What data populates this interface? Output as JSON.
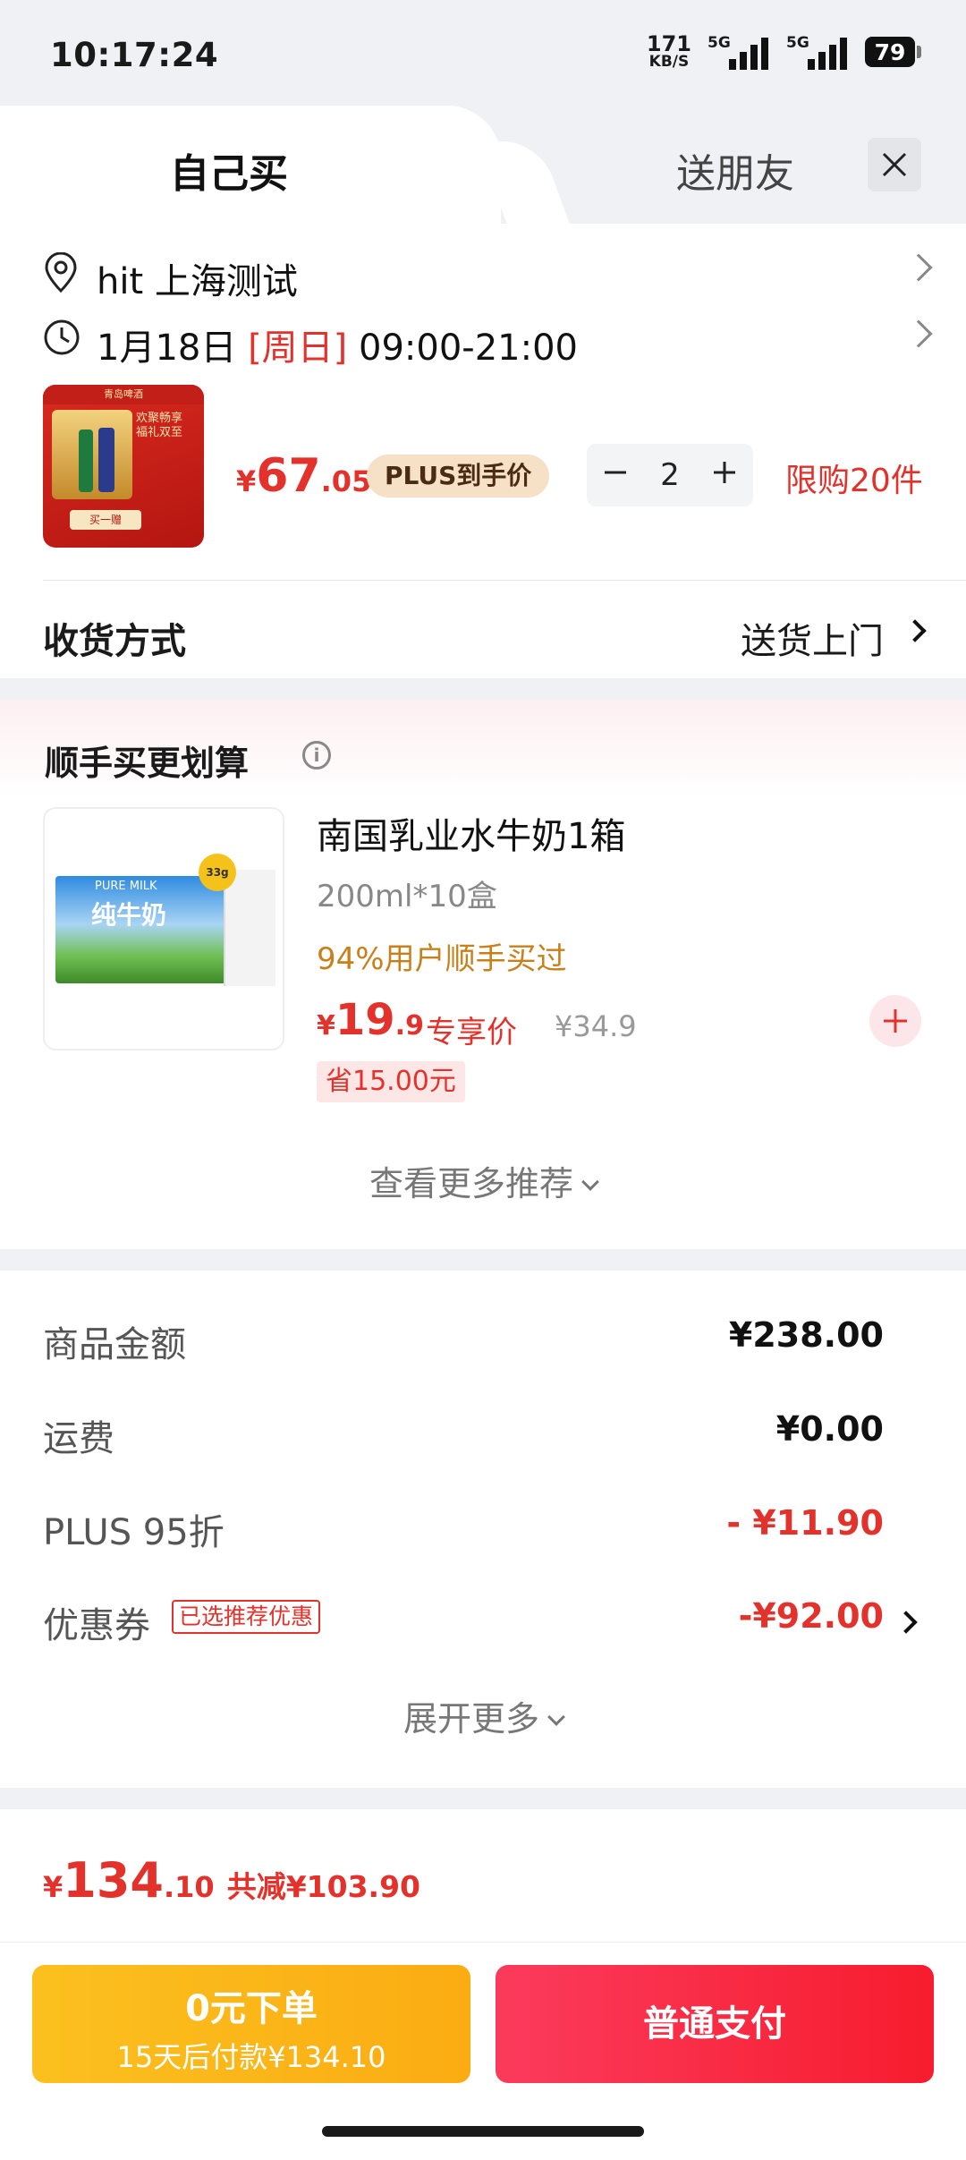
{
  "status_bar": {
    "time": "10:17:24",
    "speed_value": "171",
    "speed_unit": "KB/S",
    "network1": "5G",
    "network2": "5G",
    "battery": "79"
  },
  "tabs": {
    "self": "自己买",
    "gift": "送朋友"
  },
  "address": {
    "name": "hit",
    "text": "上海测试"
  },
  "delivery_time": {
    "date": "1月18日",
    "weekday": "[周日]",
    "range": "09:00-21:00"
  },
  "product": {
    "image_label": "product-beer-gift-box",
    "image_top": "青岛啤酒",
    "image_text": "欢聚畅享 福礼双至",
    "image_button": "买一赠",
    "price_symbol": "¥",
    "price_int": "67",
    "price_dec": ".05",
    "plus_badge": "PLUS到手价",
    "quantity": "2",
    "limit": "限购20件"
  },
  "shipping": {
    "label": "收货方式",
    "value": "送货上门"
  },
  "bundle": {
    "title": "顺手买更划算",
    "item": {
      "name": "南国乳业水牛奶1箱",
      "spec": "200ml*10盒",
      "buy_rate": "94%用户顺手买过",
      "price_symbol": "¥",
      "price_int": "19",
      "price_dec": ".9",
      "exclusive_label": "专享价",
      "original_price": "¥34.9",
      "save": "省15.00元",
      "image_brand": "PURE MILK",
      "image_title": "纯牛奶",
      "image_seal": "33g"
    },
    "see_more": "查看更多推荐"
  },
  "summary": {
    "rows": [
      {
        "label": "商品金额",
        "value": "¥238.00"
      },
      {
        "label": "运费",
        "value": "¥0.00"
      },
      {
        "label": "PLUS 95折",
        "value": "- ¥11.90"
      },
      {
        "label": "优惠券",
        "tag": "已选推荐优惠",
        "value": "-¥92.00"
      }
    ],
    "expand_more": "展开更多"
  },
  "total": {
    "symbol": "¥",
    "int": "134",
    "dec": ".10",
    "reduced": "共减¥103.90"
  },
  "buttons": {
    "zero_line1": "0元下单",
    "zero_line2": "15天后付款¥134.10",
    "pay": "普通支付"
  },
  "colors": {
    "accent_red": "#e3322b",
    "gold": "#fbb918",
    "pay_red": "#f8263f",
    "plus_badge_bg": "#f7e1c6"
  }
}
